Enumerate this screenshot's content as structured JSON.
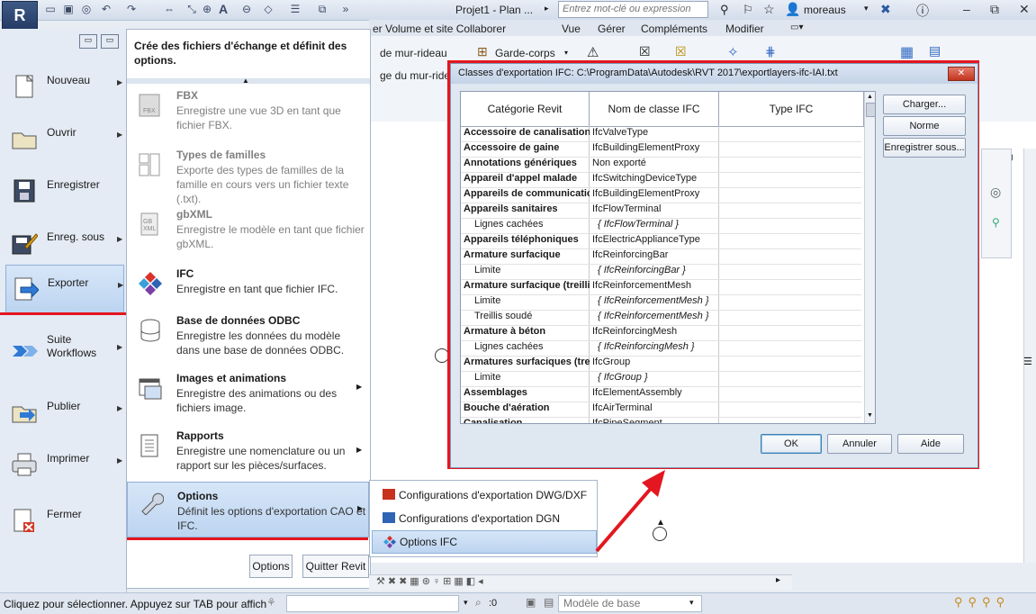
{
  "app": {
    "logo": "R",
    "doc_title": "Projet1 - Plan ...",
    "search_placeholder": "Entrez mot-clé ou expression",
    "user": "moreaus"
  },
  "ribbon": {
    "tabs": [
      "Vue",
      "Gérer",
      "Compléments",
      "Modifier"
    ],
    "tab_partial": "er  Volume et site  Collaborer",
    "line1": "de mur-rideau",
    "line2": "ge du mur-ride",
    "garde_corps": "Garde-corps"
  },
  "menu_left": [
    {
      "label": "Nouveau",
      "icon": "new-document-icon"
    },
    {
      "label": "Ouvrir",
      "icon": "folder-open-icon"
    },
    {
      "label": "Enregistrer",
      "icon": "save-icon"
    },
    {
      "label": "Enreg. sous",
      "icon": "save-as-icon"
    },
    {
      "label": "Exporter",
      "icon": "export-icon"
    },
    {
      "label": "Suite\nWorkflows",
      "icon": "suite-workflows-icon"
    },
    {
      "label": "Publier",
      "icon": "publish-icon"
    },
    {
      "label": "Imprimer",
      "icon": "printer-icon"
    },
    {
      "label": "Fermer",
      "icon": "close-document-icon"
    }
  ],
  "submenu": {
    "header": "Crée des fichiers d'échange et définit des options.",
    "items": [
      {
        "title": "FBX",
        "desc": "Enregistre une vue 3D en tant que fichier FBX."
      },
      {
        "title": "Types de familles",
        "desc": "Exporte des types de familles de la famille en cours vers un fichier texte (.txt)."
      },
      {
        "title": "gbXML",
        "desc": "Enregistre le modèle en tant que fichier gbXML."
      },
      {
        "title": "IFC",
        "desc": "Enregistre en tant que fichier IFC."
      },
      {
        "title": "Base de données ODBC",
        "desc": "Enregistre les données du modèle dans une base de données ODBC."
      },
      {
        "title": "Images et animations",
        "desc": "Enregistre des animations ou des fichiers image."
      },
      {
        "title": "Rapports",
        "desc": "Enregistre une nomenclature ou un rapport sur les pièces/surfaces."
      },
      {
        "title": "Options",
        "desc": "Définit les options d'exportation CAO et IFC."
      }
    ],
    "buttons": {
      "options": "Options",
      "quit": "Quitter Revit"
    }
  },
  "flyout": [
    "Configurations d'exportation DWG/DXF",
    "Configurations d'exportation DGN",
    "Options IFC"
  ],
  "dialog": {
    "title": "Classes d'exportation IFC: C:\\ProgramData\\Autodesk\\RVT 2017\\exportlayers-ifc-IAI.txt",
    "close": "✕",
    "columns": [
      "Catégorie Revit",
      "Nom de classe IFC",
      "Type IFC"
    ],
    "rows": [
      {
        "cat": "Accessoire de canalisation",
        "ifc": "IfcValveType",
        "style": "bold"
      },
      {
        "cat": "Accessoire de gaine",
        "ifc": "IfcBuildingElementProxy",
        "style": "bold"
      },
      {
        "cat": "Annotations génériques",
        "ifc": "Non exporté",
        "style": "bold"
      },
      {
        "cat": "Appareil d'appel malade",
        "ifc": "IfcSwitchingDeviceType",
        "style": "bold"
      },
      {
        "cat": "Appareils de communication",
        "ifc": "IfcBuildingElementProxy",
        "style": "bold"
      },
      {
        "cat": "Appareils sanitaires",
        "ifc": "IfcFlowTerminal",
        "style": "bold"
      },
      {
        "cat": "Lignes cachées",
        "ifc": "{ IfcFlowTerminal }",
        "style": "sub"
      },
      {
        "cat": "Appareils téléphoniques",
        "ifc": "IfcElectricApplianceType",
        "style": "bold"
      },
      {
        "cat": "Armature surfacique",
        "ifc": "IfcReinforcingBar",
        "style": "bold"
      },
      {
        "cat": "Limite",
        "ifc": "{ IfcReinforcingBar }",
        "style": "sub"
      },
      {
        "cat": "Armature surfacique (treillis",
        "ifc": "IfcReinforcementMesh",
        "style": "bold"
      },
      {
        "cat": "Limite",
        "ifc": "{ IfcReinforcementMesh }",
        "style": "sub"
      },
      {
        "cat": "Treillis soudé",
        "ifc": "{ IfcReinforcementMesh }",
        "style": "sub"
      },
      {
        "cat": "Armature à béton",
        "ifc": "IfcReinforcingMesh",
        "style": "bold"
      },
      {
        "cat": "Lignes cachées",
        "ifc": "{ IfcReinforcingMesh }",
        "style": "sub"
      },
      {
        "cat": "Armatures surfaciques (treil",
        "ifc": "IfcGroup",
        "style": "bold"
      },
      {
        "cat": "Limite",
        "ifc": "{ IfcGroup }",
        "style": "sub"
      },
      {
        "cat": "Assemblages",
        "ifc": "IfcElementAssembly",
        "style": "bold"
      },
      {
        "cat": "Bouche d'aération",
        "ifc": "IfcAirTerminal",
        "style": "bold"
      },
      {
        "cat": "Canalisation",
        "ifc": "IfcPipeSegment",
        "style": "bold"
      }
    ],
    "side_buttons": [
      "Charger...",
      "Norme",
      "Enregistrer sous..."
    ],
    "bottom_buttons": {
      "ok": "OK",
      "cancel": "Annuler",
      "help": "Aide"
    }
  },
  "status": {
    "text": "Cliquez pour sélectionner. Appuyez sur TAB pour affich",
    "zero": ":0",
    "model": "Modèle de base"
  },
  "colors": {
    "accent_red": "#e4161f",
    "selection": "#bcd4f0"
  }
}
